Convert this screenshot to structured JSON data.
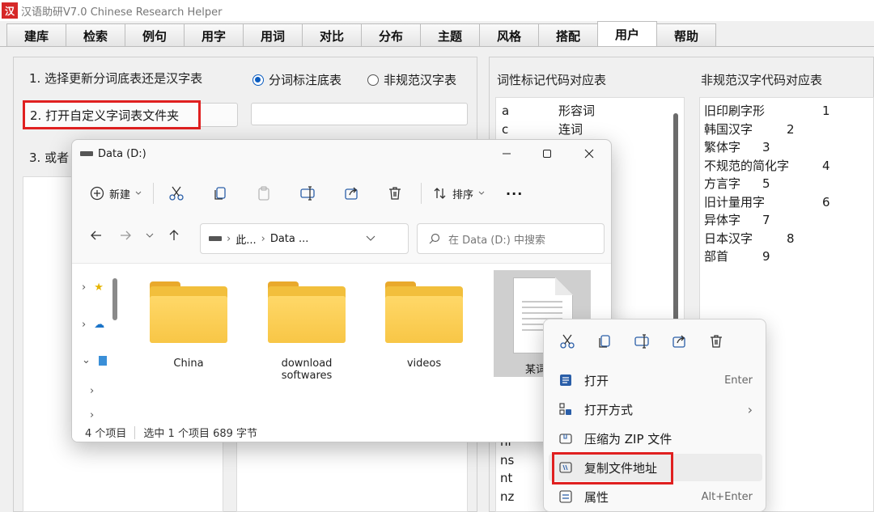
{
  "app": {
    "logo": "汉",
    "title": "汉语助研V7.0  Chinese Research Helper",
    "tabs": [
      "建库",
      "检索",
      "例句",
      "用字",
      "用词",
      "对比",
      "分布",
      "主题",
      "风格",
      "搭配",
      "用户",
      "帮助"
    ],
    "active_tab": "用户"
  },
  "left_panel": {
    "step1": "1. 选择更新分词底表还是汉字表",
    "radio_segmentation": "分词标注底表",
    "radio_nonstandard": "非规范汉字表",
    "step2_button": "2. 打开自定义字词表文件夹",
    "step3": "3. 或者"
  },
  "right_panel": {
    "pos_title": "词性标记代码对应表",
    "nonstd_title": "非规范汉字代码对应表",
    "pos_codes": [
      {
        "code": "a",
        "name": "形容词"
      },
      {
        "code": "c",
        "name": "连词"
      }
    ],
    "pos_codes_bottom": [
      "nl",
      "ns",
      "nt",
      "nz"
    ],
    "nonstd_codes": [
      {
        "name": "旧印刷字形",
        "code": "1"
      },
      {
        "name": "韩国汉字",
        "code": "2"
      },
      {
        "name": "繁体字",
        "code": "3"
      },
      {
        "name": "不规范的简化字",
        "code": "4"
      },
      {
        "name": "方言字",
        "code": "5"
      },
      {
        "name": "旧计量用字",
        "code": "6"
      },
      {
        "name": "异体字",
        "code": "7"
      },
      {
        "name": "日本汉字",
        "code": "8"
      },
      {
        "name": "部首",
        "code": "9"
      }
    ]
  },
  "explorer": {
    "title": "Data (D:)",
    "new_label": "新建",
    "sort_label": "排序",
    "more": "···",
    "address_seg1": "此...",
    "address_seg2": "Data ...",
    "search_placeholder": "在 Data (D:) 中搜索",
    "files": [
      {
        "name": "China"
      },
      {
        "name": "download softwares"
      },
      {
        "name": "videos"
      },
      {
        "name": "某词"
      }
    ],
    "status_count": "4 个项目",
    "status_selected": "选中 1 个项目  689 字节"
  },
  "context_menu": {
    "items": [
      {
        "label": "打开",
        "shortcut": "Enter"
      },
      {
        "label": "打开方式",
        "shortcut": "›"
      },
      {
        "label": "压缩为 ZIP 文件",
        "shortcut": ""
      },
      {
        "label": "复制文件地址",
        "shortcut": ""
      },
      {
        "label": "属性",
        "shortcut": "Alt+Enter"
      }
    ]
  },
  "colors": {
    "highlight_red": "#e02020",
    "folder_yellow": "#f8c646",
    "radio_blue": "#0a5cc0"
  }
}
